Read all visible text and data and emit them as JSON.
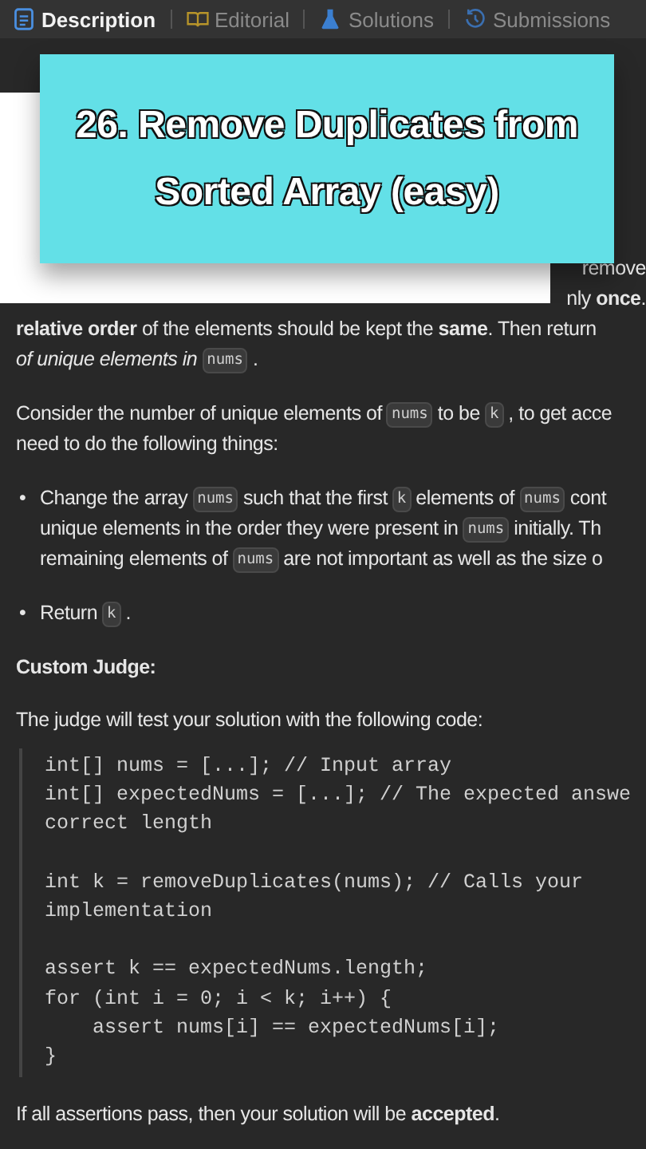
{
  "tabs": [
    {
      "label": "Description",
      "selected": true,
      "kind": "doc"
    },
    {
      "label": "Editorial",
      "selected": false,
      "kind": "book"
    },
    {
      "label": "Solutions",
      "selected": false,
      "kind": "flask"
    },
    {
      "label": "Submissions",
      "selected": false,
      "kind": "history"
    }
  ],
  "overlay_title": "26. Remove Duplicates from Sorted Array (easy)",
  "hidden_fragments": [
    "remove",
    "nly **once**."
  ],
  "description": [
    {
      "kind": "line",
      "segments": [
        {
          "kind": "text",
          "text": "**relative order** of the elements should be kept the **same**. Then return"
        }
      ]
    },
    {
      "kind": "line",
      "segments": [
        {
          "kind": "text",
          "text": "*of unique elements in*"
        },
        {
          "kind": "code",
          "text": "nums"
        },
        {
          "kind": "text",
          "text": "."
        }
      ]
    },
    {
      "kind": "gap"
    },
    {
      "kind": "line",
      "segments": [
        {
          "kind": "text",
          "text": "Consider the number of unique elements of"
        },
        {
          "kind": "code",
          "text": "nums"
        },
        {
          "kind": "text",
          "text": "to be"
        },
        {
          "kind": "code",
          "text": "k"
        },
        {
          "kind": "text",
          "text": ", to get acce"
        }
      ]
    },
    {
      "kind": "line",
      "segments": [
        {
          "kind": "text",
          "text": "need to do the following things:"
        }
      ]
    },
    {
      "kind": "gap"
    },
    {
      "kind": "bullet",
      "segments": [
        {
          "kind": "text",
          "text": "Change the array"
        },
        {
          "kind": "code",
          "text": "nums"
        },
        {
          "kind": "text",
          "text": "such that the first"
        },
        {
          "kind": "code",
          "text": "k"
        },
        {
          "kind": "text",
          "text": "elements of"
        },
        {
          "kind": "code",
          "text": "nums"
        },
        {
          "kind": "text",
          "text": "cont"
        }
      ]
    },
    {
      "kind": "indent",
      "segments": [
        {
          "kind": "text",
          "text": "unique elements in the order they were present in"
        },
        {
          "kind": "code",
          "text": "nums"
        },
        {
          "kind": "text",
          "text": "initially. Th"
        }
      ]
    },
    {
      "kind": "indent",
      "segments": [
        {
          "kind": "text",
          "text": "remaining elements of"
        },
        {
          "kind": "code",
          "text": "nums"
        },
        {
          "kind": "text",
          "text": "are not important as well as the size o"
        }
      ]
    },
    {
      "kind": "gap"
    },
    {
      "kind": "bullet",
      "segments": [
        {
          "kind": "text",
          "text": "Return"
        },
        {
          "kind": "code",
          "text": "k"
        },
        {
          "kind": "text",
          "text": "."
        }
      ]
    }
  ],
  "bullet_mark": "•",
  "custom_judge_heading": "Custom Judge:",
  "judge_intro": "The judge will test your solution with the following code:",
  "code_blocks": [
    [
      "int[] nums = [...]; // Input array",
      "int[] expectedNums = [...]; // The expected answe",
      "correct length"
    ],
    [
      "int k = removeDuplicates(nums); // Calls your",
      "implementation"
    ],
    [
      "assert k == expectedNums.length;",
      "for (int i = 0; i < k; i++) {",
      "    assert nums[i] == expectedNums[i];",
      "}"
    ]
  ],
  "closing": "If all assertions pass, then your solution will be **accepted**."
}
